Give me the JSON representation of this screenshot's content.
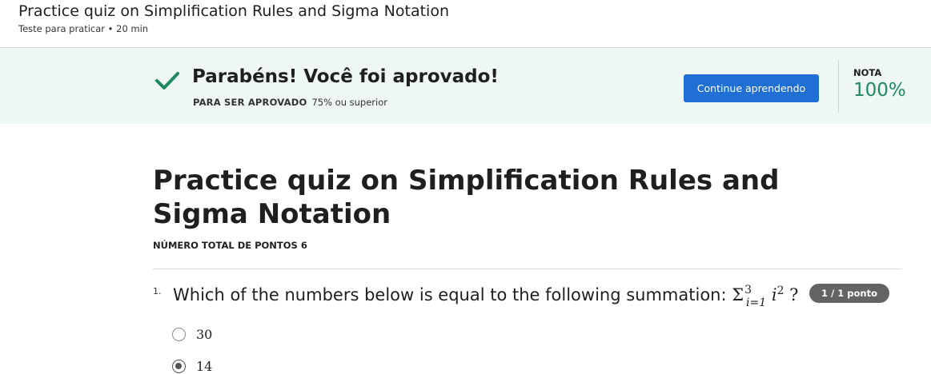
{
  "header": {
    "title": "Practice quiz on Simplification Rules and Sigma Notation",
    "meta": "Teste para praticar • 20 min"
  },
  "banner": {
    "congrats": "Parabéns! Você foi aprovado!",
    "pass_label": "PARA SER APROVADO",
    "pass_requirement": "75% ou superior",
    "continue_button": "Continue aprendendo",
    "grade_label": "NOTA",
    "grade_value": "100%",
    "icon": "check-icon",
    "colors": {
      "banner_bg": "#eef7f3",
      "check": "#1e8a5e",
      "button": "#1f6fd4",
      "grade": "#1e8a5e"
    }
  },
  "quiz": {
    "title": "Practice quiz on Simplification Rules and Sigma Notation",
    "total_points": "NÚMERO TOTAL DE PONTOS 6"
  },
  "question": {
    "number": "1.",
    "text": "Which of the numbers below is equal to the following summation:",
    "math": {
      "sigma": "Σ",
      "upper": "3",
      "lower": "i=1",
      "term": "i",
      "power": "2",
      "suffix": "?"
    },
    "points_badge": "1 / 1 ponto",
    "options": [
      {
        "label": "30",
        "selected": false
      },
      {
        "label": "14",
        "selected": true
      }
    ]
  }
}
